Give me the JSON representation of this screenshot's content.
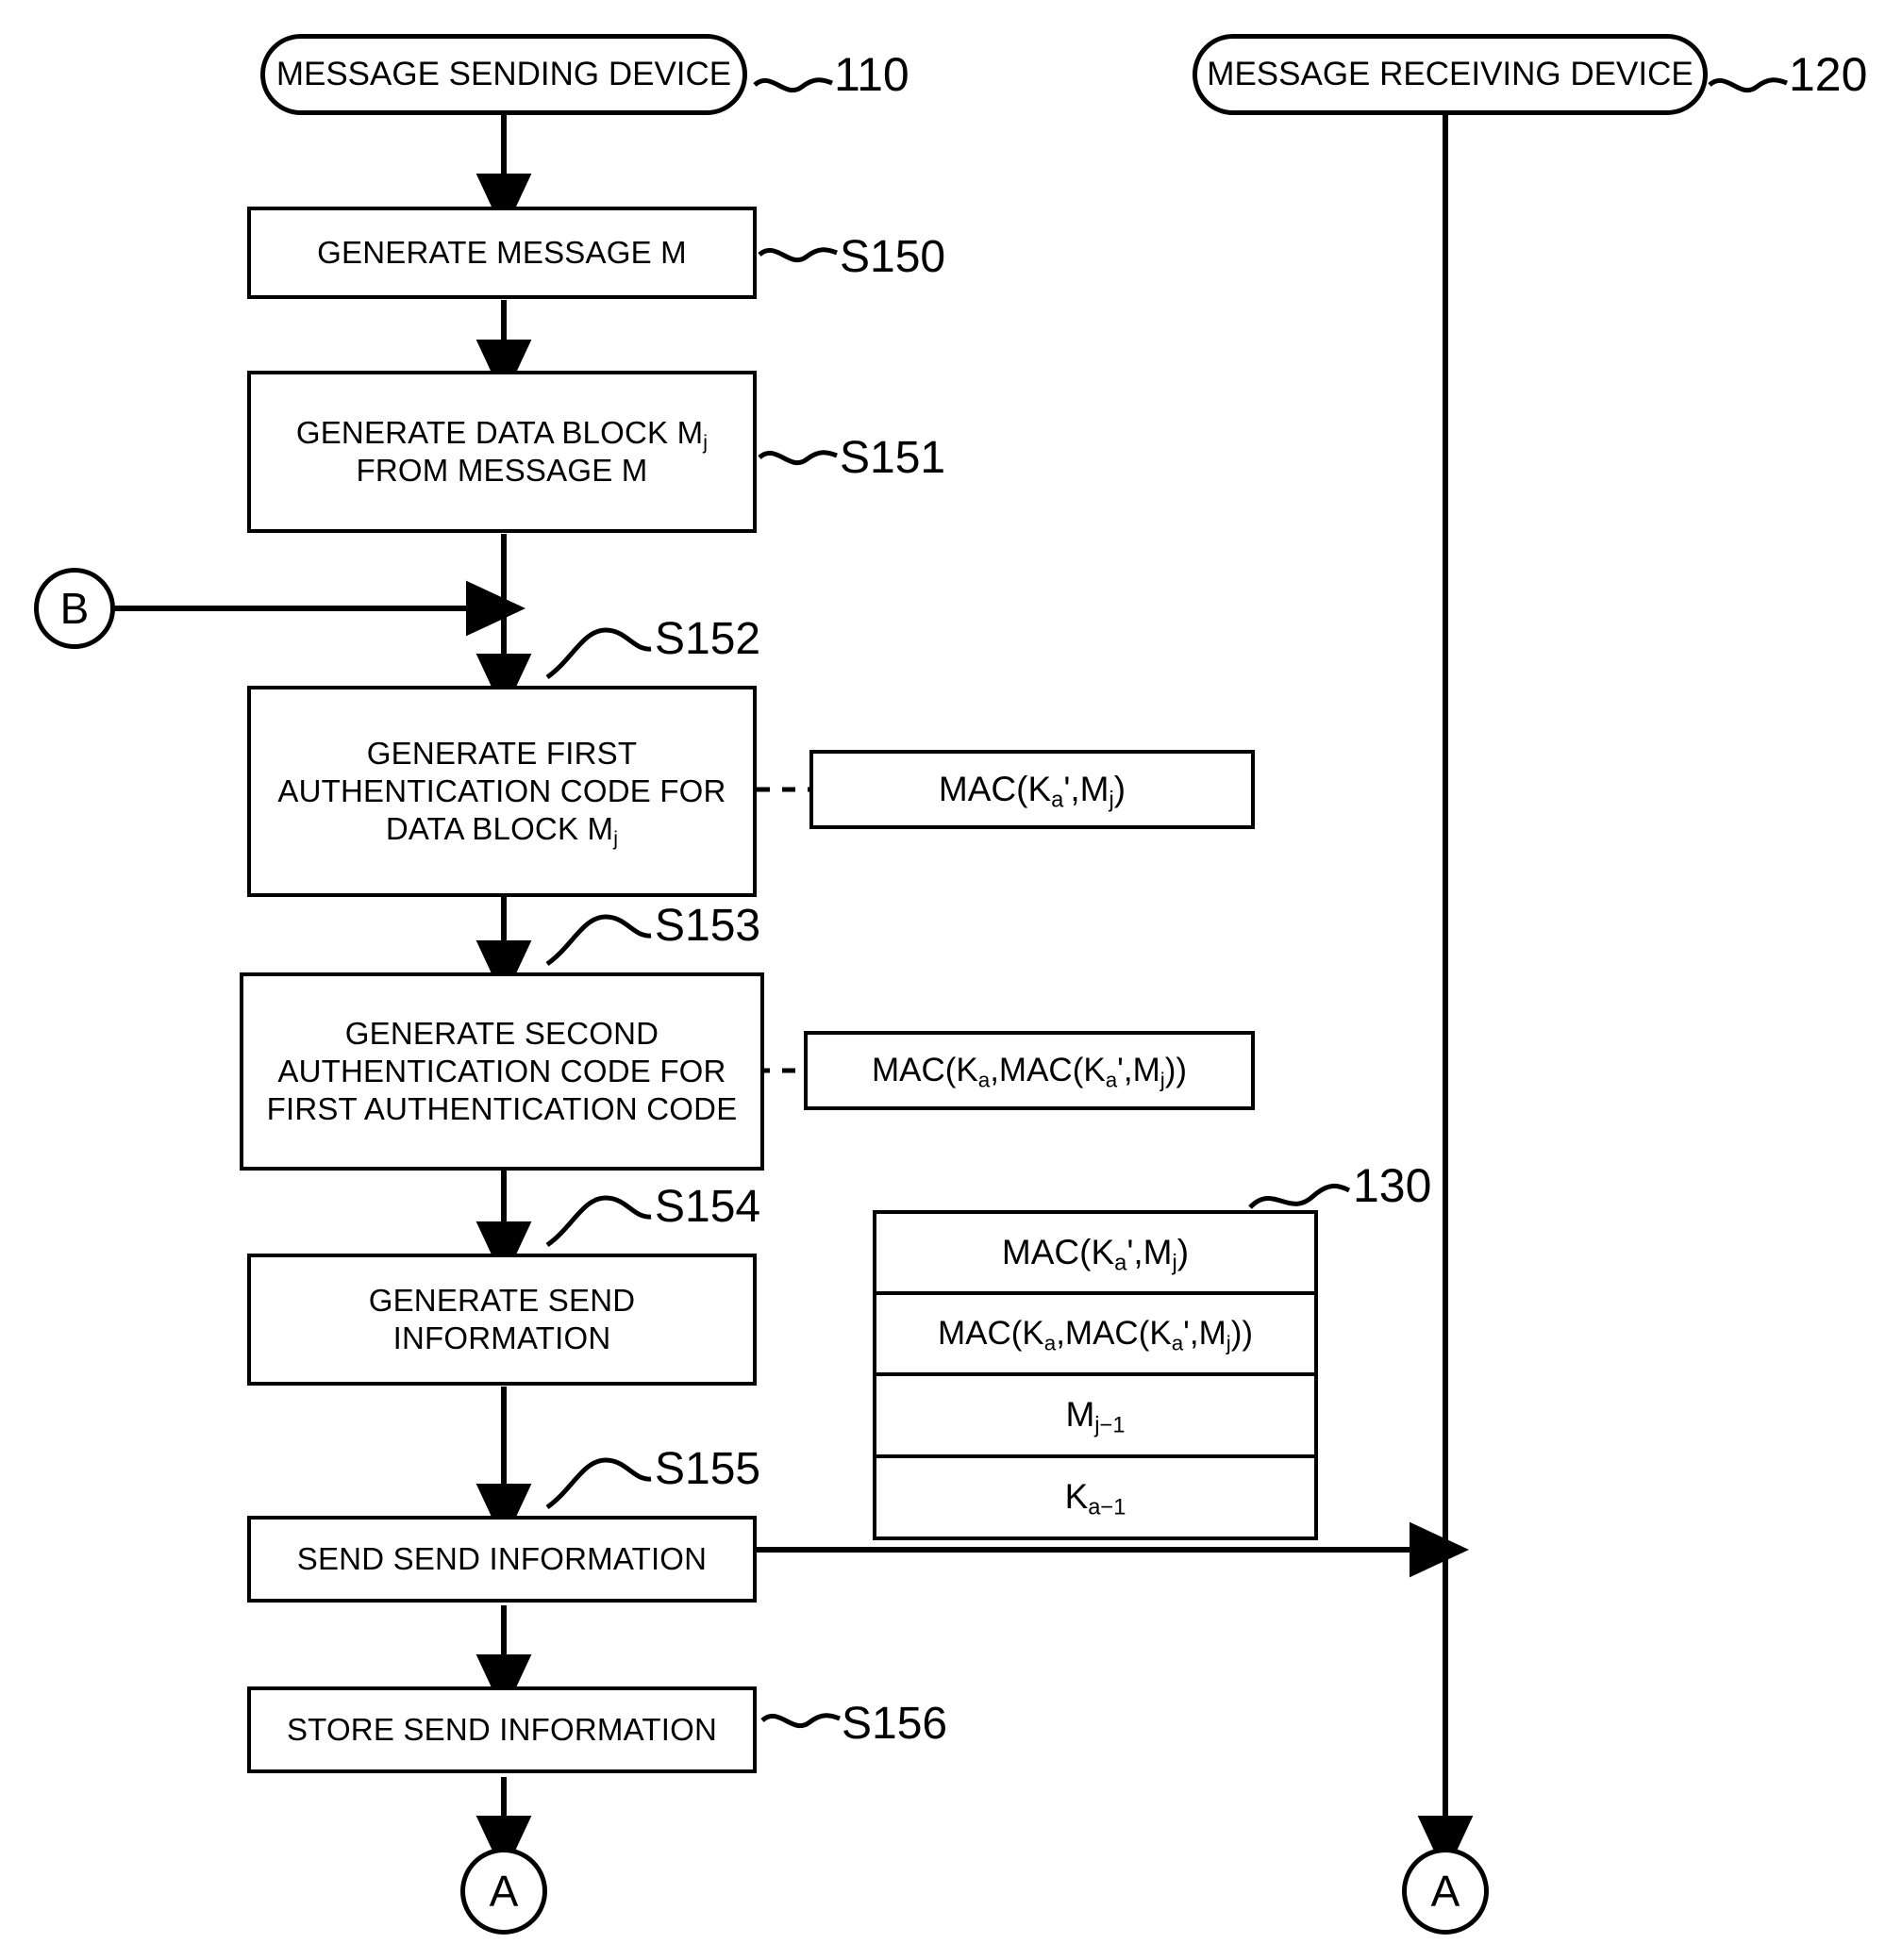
{
  "diagram": {
    "title": "Message authentication flowchart (sending device)",
    "lanes": [
      {
        "id": "sending",
        "terminator": "MESSAGE SENDING DEVICE",
        "ref": "110"
      },
      {
        "id": "receiving",
        "terminator": "MESSAGE RECEIVING DEVICE",
        "ref": "120"
      }
    ],
    "connectors": {
      "entry_b": "B",
      "exit_a_left": "A",
      "exit_a_right": "A"
    },
    "steps": [
      {
        "id": "s150",
        "label": "S150",
        "line1": "GENERATE MESSAGE M",
        "line2": "",
        "line3": ""
      },
      {
        "id": "s151",
        "label": "S151",
        "line1": "GENERATE DATA BLOCK M",
        "line1_sub": "j",
        "line2": "FROM MESSAGE M",
        "line3": ""
      },
      {
        "id": "s152",
        "label": "S152",
        "line1": "GENERATE FIRST",
        "line2": "AUTHENTICATION CODE FOR",
        "line3": "DATA BLOCK M",
        "line3_sub": "j"
      },
      {
        "id": "s153",
        "label": "S153",
        "line1": "GENERATE SECOND",
        "line2": "AUTHENTICATION CODE FOR",
        "line3": "FIRST AUTHENTICATION CODE"
      },
      {
        "id": "s154",
        "label": "S154",
        "line1": "GENERATE SEND",
        "line2": "INFORMATION",
        "line3": ""
      },
      {
        "id": "s155",
        "label": "S155",
        "line1": "SEND SEND INFORMATION",
        "line2": "",
        "line3": ""
      },
      {
        "id": "s156",
        "label": "S156",
        "line1": "STORE SEND INFORMATION",
        "line2": "",
        "line3": ""
      }
    ],
    "formulas": [
      {
        "id": "f152",
        "attached_to": "s152",
        "text_main": "MAC(K",
        "sub_a1": "a",
        "prime": "',M",
        "sub_j1": "j",
        "tail": ")"
      },
      {
        "id": "f153",
        "attached_to": "s153",
        "text_main": "MAC(K",
        "sub_a1": "a",
        "mid": ",MAC(K",
        "sub_a2": "a",
        "prime": "',M",
        "sub_j1": "j",
        "tail": "))"
      }
    ],
    "store": {
      "ref": "130",
      "rows": [
        {
          "id": "row1",
          "kind": "mac1"
        },
        {
          "id": "row2",
          "kind": "mac2"
        },
        {
          "id": "row3",
          "kind": "mprev"
        },
        {
          "id": "row4",
          "kind": "kprev"
        }
      ],
      "row_text": {
        "mac1": "MAC(Ka',Mj)",
        "mac2": "MAC(Ka,MAC(Ka',Mj))",
        "mprev": "Mj-1",
        "kprev": "Ka-1"
      }
    },
    "colors": {
      "stroke": "#000000",
      "fill": "#ffffff"
    }
  }
}
